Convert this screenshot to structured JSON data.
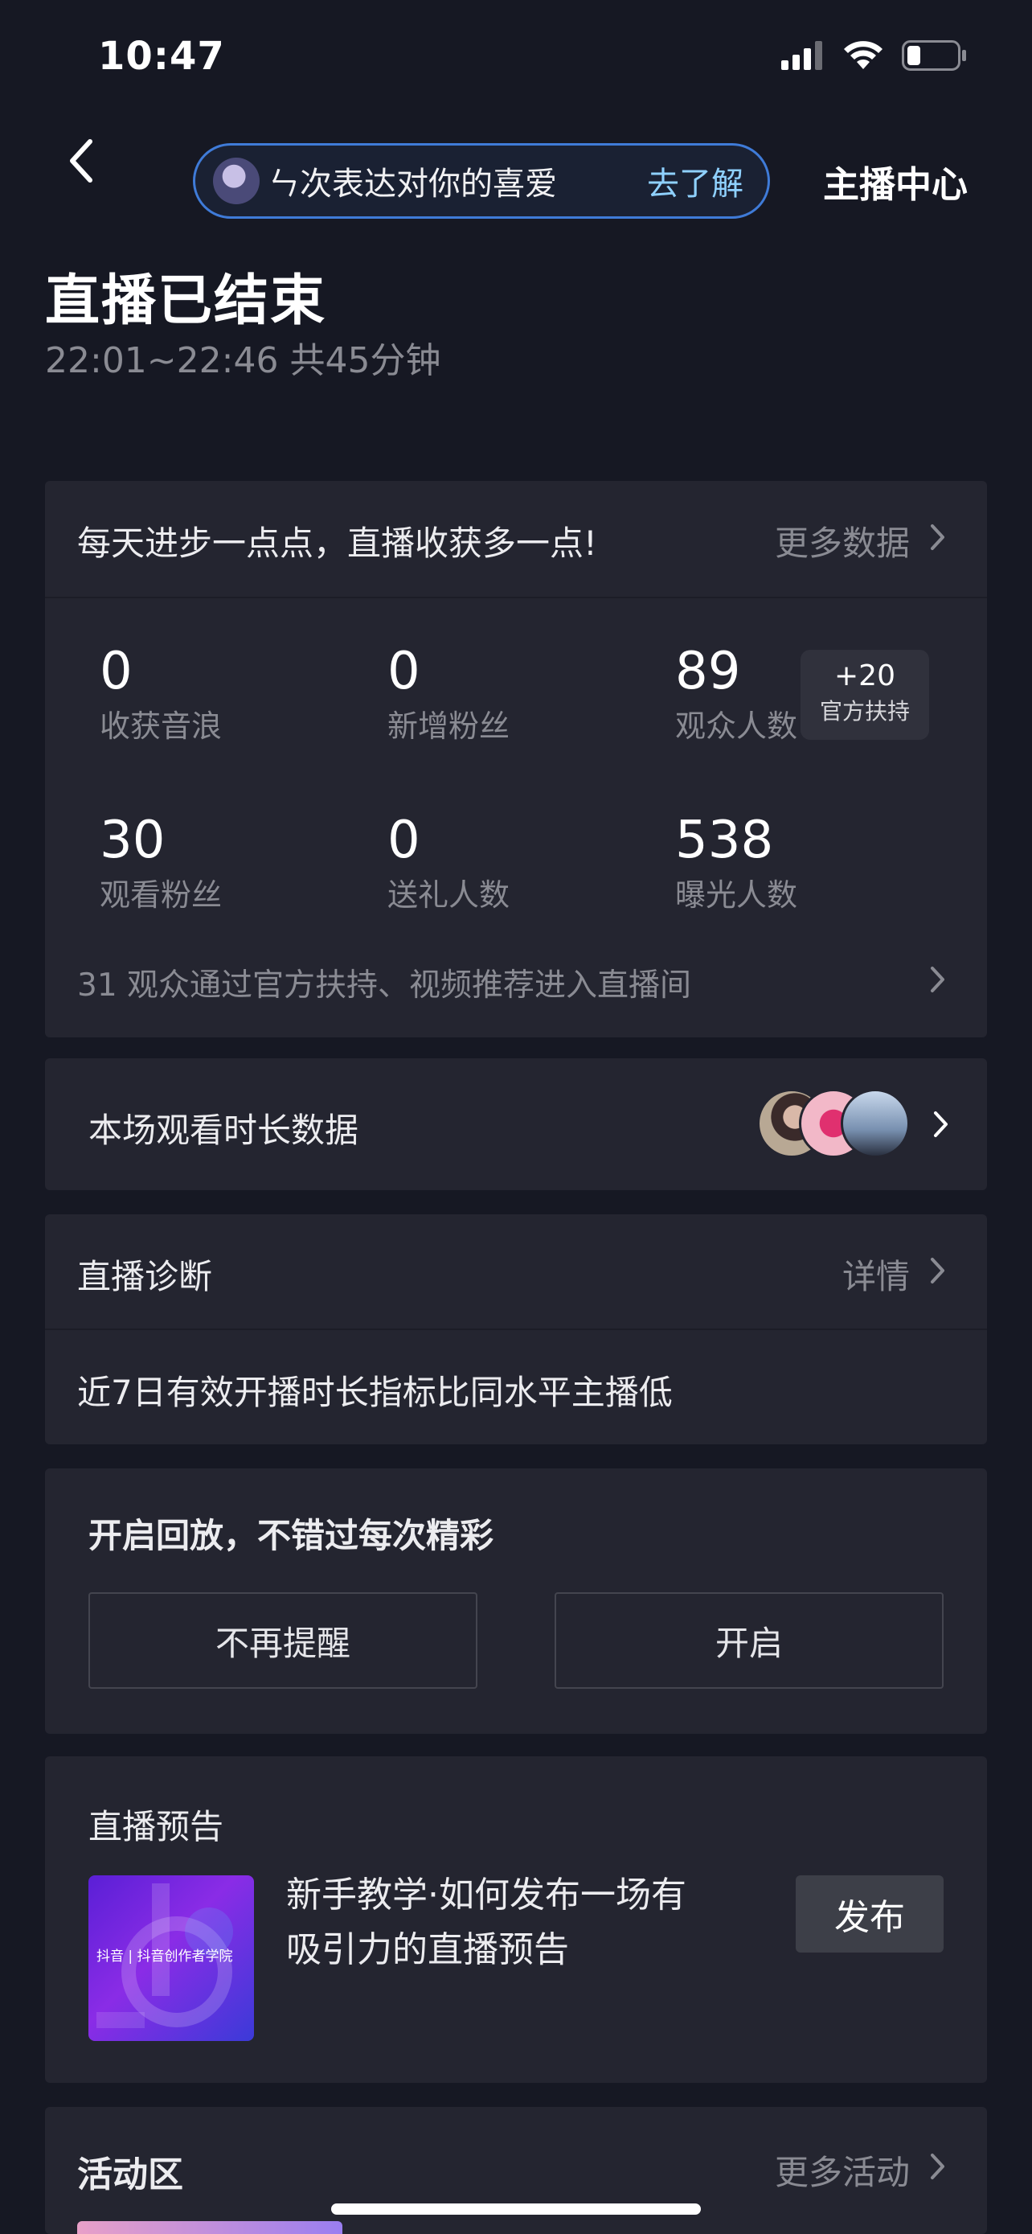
{
  "status_bar": {
    "time": "10:47"
  },
  "header": {
    "pill_text": "ㄣ次表达对你的喜爱",
    "pill_link": "去了解",
    "host_center": "主播中心"
  },
  "summary": {
    "title": "直播已结束",
    "time_range": "22:01~22:46 共45分钟"
  },
  "stats_card": {
    "heading": "每天进步一点点，直播收获多一点!",
    "more_link": "更多数据",
    "stats": [
      {
        "value": "0",
        "label": "收获音浪"
      },
      {
        "value": "0",
        "label": "新增粉丝"
      },
      {
        "value": "89",
        "label": "观众人数"
      },
      {
        "value": "30",
        "label": "观看粉丝"
      },
      {
        "value": "0",
        "label": "送礼人数"
      },
      {
        "value": "538",
        "label": "曝光人数"
      }
    ],
    "badge": {
      "top": "+20",
      "bottom": "官方扶持"
    },
    "footer": "31 观众通过官方扶持、视频推荐进入直播间"
  },
  "watch_time_card": {
    "label": "本场观看时长数据"
  },
  "diagnosis_card": {
    "title": "直播诊断",
    "details": "详情",
    "note": "近7日有效开播时长指标比同水平主播低"
  },
  "replay_card": {
    "title": "开启回放，不错过每次精彩",
    "dismiss_label": "不再提醒",
    "enable_label": "开启"
  },
  "preview_card": {
    "title": "直播预告",
    "thumb_caption": "抖音 | 抖音创作者学院",
    "description_line1": "新手教学·如何发布一场有",
    "description_line2": "吸引力的直播预告",
    "publish_label": "发布"
  },
  "activity_card": {
    "title": "活动区",
    "more_link": "更多活动"
  },
  "colors": {
    "background": "#161823",
    "card": "#242530",
    "accent_blue": "#3f7bd8",
    "link_cyan": "#8fd1ff"
  }
}
